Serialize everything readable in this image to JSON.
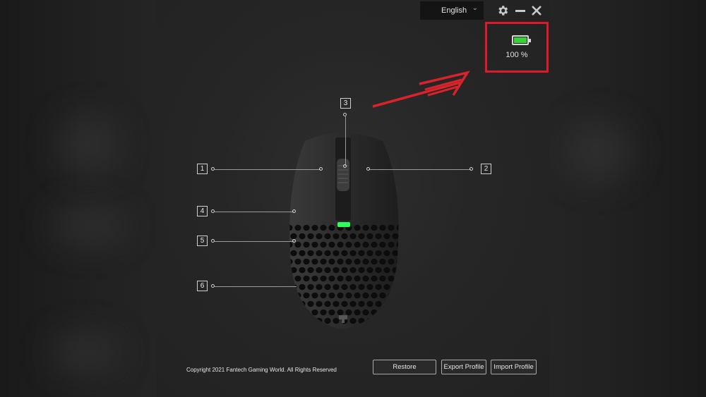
{
  "window": {
    "language_selector": {
      "value": "English"
    },
    "icons": {
      "settings": "gear-icon",
      "minimize": "minimize-icon",
      "close": "close-icon",
      "dropdown": "chevron-down-icon"
    }
  },
  "battery": {
    "level": 1.0,
    "text": "100 %",
    "fill_color": "#39d13a",
    "highlight_color": "#e0192a"
  },
  "mouse_buttons": [
    {
      "id": "1",
      "label": "1"
    },
    {
      "id": "2",
      "label": "2"
    },
    {
      "id": "3",
      "label": "3"
    },
    {
      "id": "4",
      "label": "4"
    },
    {
      "id": "5",
      "label": "5"
    },
    {
      "id": "6",
      "label": "6"
    }
  ],
  "footer": {
    "copyright": "Copyright  2021 Fantech Gaming World. All Rights Reserved",
    "restore_label": "Restore",
    "export_label": "Export Profile",
    "import_label": "Import Profile"
  },
  "colors": {
    "led": "#2cff5a",
    "annotation_arrow": "#d8232a"
  }
}
